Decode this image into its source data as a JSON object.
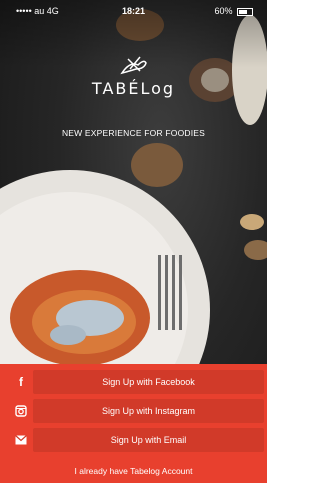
{
  "status_bar": {
    "carrier": "••••• au 4G",
    "time": "18:21",
    "battery": "60%"
  },
  "brand": {
    "name": "TABÉLog"
  },
  "tagline": "NEW EXPERIENCE FOR FOODIES",
  "buttons": {
    "facebook": "Sign Up with Facebook",
    "instagram": "Sign Up with Instagram",
    "email": "Sign Up with Email"
  },
  "account_link": "I already have Tabelog Account",
  "colors": {
    "panel": "#e8402e",
    "button": "#d13a29"
  },
  "icons": [
    "facebook-icon",
    "instagram-icon",
    "email-icon",
    "chef-logo-icon"
  ]
}
